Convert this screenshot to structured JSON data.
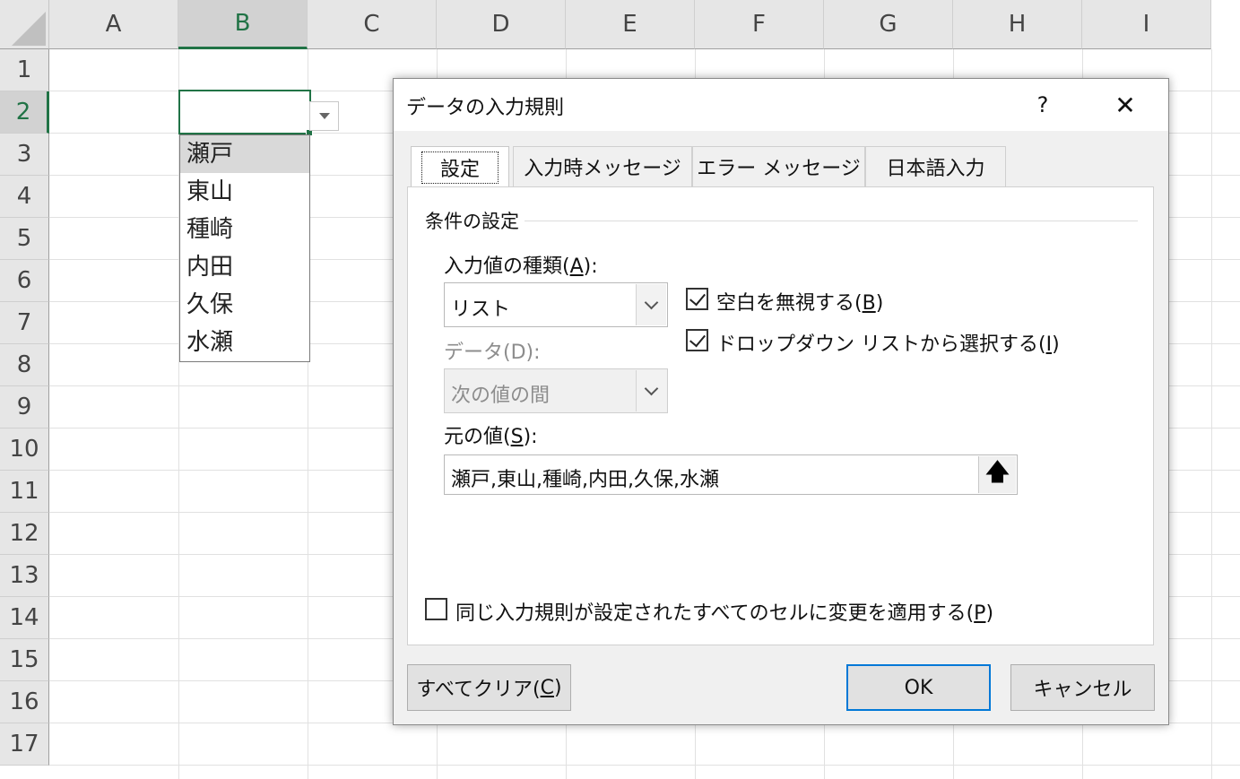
{
  "sheet": {
    "columns": [
      "A",
      "B",
      "C",
      "D",
      "E",
      "F",
      "G",
      "H",
      "I"
    ],
    "rows": [
      "1",
      "2",
      "3",
      "4",
      "5",
      "6",
      "7",
      "8",
      "9",
      "10",
      "11",
      "12",
      "13",
      "14",
      "15",
      "16",
      "17"
    ],
    "selected_column": "B",
    "selected_row": "2",
    "accent_color": "#217346"
  },
  "dropdown": {
    "items": [
      "瀬戸",
      "東山",
      "種崎",
      "内田",
      "久保",
      "水瀬"
    ],
    "highlighted_index": 0
  },
  "dialog": {
    "title": "データの入力規則",
    "help": "?",
    "close": "✕",
    "tabs": [
      "設定",
      "入力時メッセージ",
      "エラー メッセージ",
      "日本語入力"
    ],
    "active_tab": "設定",
    "group_title": "条件の設定",
    "allow_label_pre": "入力値の種類(",
    "allow_label_key": "A",
    "allow_label_post": "):",
    "allow_value": "リスト",
    "data_label": "データ(D):",
    "data_value": "次の値の間",
    "ignore_blank_pre": "空白を無視する(",
    "ignore_blank_key": "B",
    "ignore_blank_post": ")",
    "ignore_blank_checked": true,
    "in_cell_dropdown_pre": "ドロップダウン リストから選択する(",
    "in_cell_dropdown_key": "I",
    "in_cell_dropdown_post": ")",
    "in_cell_dropdown_checked": true,
    "source_label_pre": "元の値(",
    "source_label_key": "S",
    "source_label_post": "):",
    "source_value": "瀬戸,東山,種崎,内田,久保,水瀬",
    "apply_all_pre": "同じ入力規則が設定されたすべてのセルに変更を適用する(",
    "apply_all_key": "P",
    "apply_all_post": ")",
    "apply_all_checked": false,
    "clear_all_pre": "すべてクリア(",
    "clear_all_key": "C",
    "clear_all_post": ")",
    "ok": "OK",
    "cancel": "キャンセル",
    "default_button_color": "#0078d7"
  }
}
